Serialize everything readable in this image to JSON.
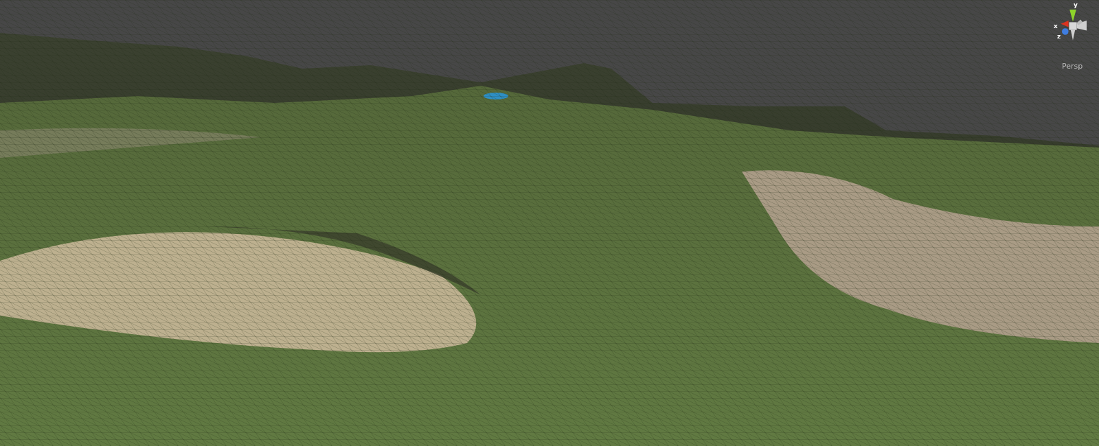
{
  "scene_view": {
    "gizmo": {
      "axes": [
        {
          "label": "y",
          "kind": "y"
        },
        {
          "label": "x",
          "kind": "x"
        },
        {
          "label": "z",
          "kind": "z"
        }
      ],
      "projection": "Persp"
    }
  }
}
